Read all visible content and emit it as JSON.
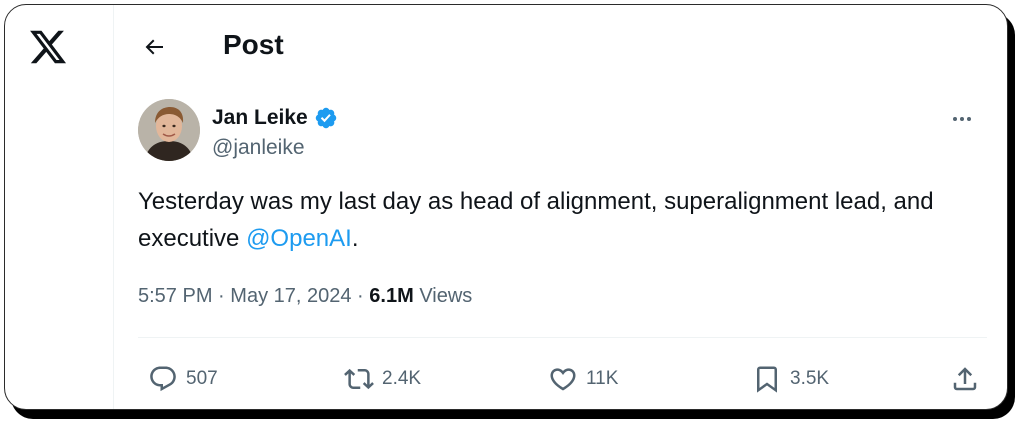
{
  "header": {
    "title": "Post",
    "back_icon": "arrow-left-icon",
    "logo_icon": "x-logo-icon"
  },
  "author": {
    "name": "Jan Leike",
    "handle": "@janleike",
    "verified_icon": "verified-badge-icon",
    "verified_color": "#1d9bf0"
  },
  "post": {
    "text_before": "Yesterday was my last day as head of alignment, superalignment lead, and executive ",
    "mention": "@OpenAI",
    "text_after": ".",
    "time": "5:57 PM",
    "date": "May 17, 2024",
    "separator": "·",
    "views_count": "6.1M",
    "views_label": "Views"
  },
  "actions": {
    "replies": "507",
    "reposts": "2.4K",
    "likes": "11K",
    "bookmarks": "3.5K"
  },
  "colors": {
    "accent": "#1d9bf0",
    "text": "#0f1419",
    "muted": "#536471"
  }
}
